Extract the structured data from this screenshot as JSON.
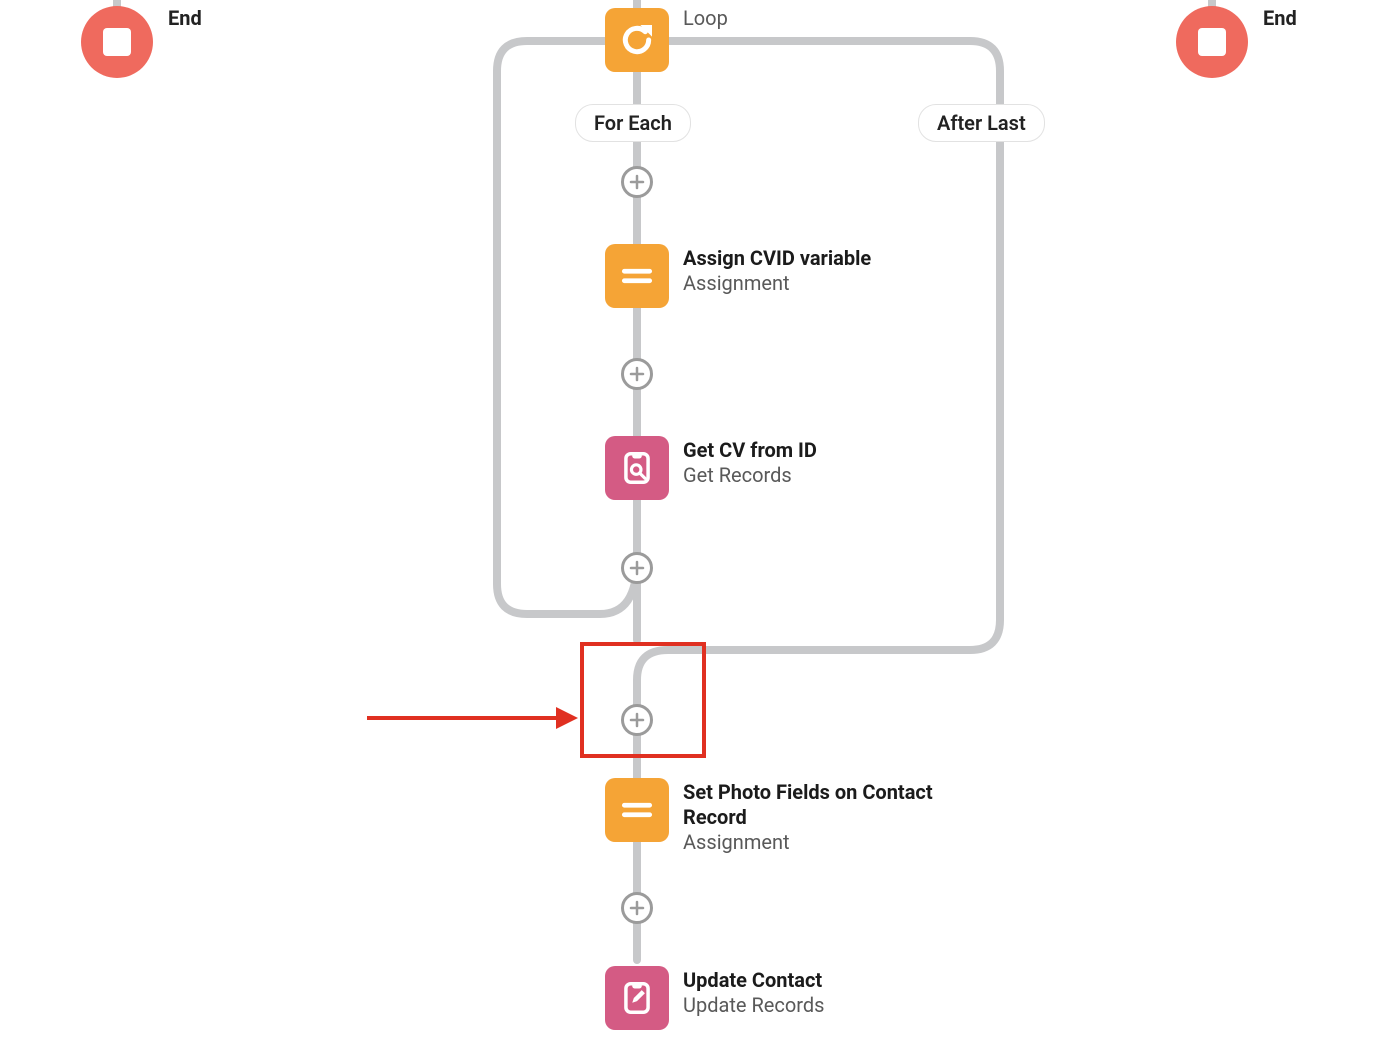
{
  "end_nodes": {
    "left": {
      "label": "End"
    },
    "right": {
      "label": "End"
    }
  },
  "loop": {
    "title": "",
    "subtitle": "Loop",
    "for_each_label": "For Each",
    "after_last_label": "After Last"
  },
  "elements": {
    "assign_cvid": {
      "title": "Assign CVID variable",
      "subtitle": "Assignment"
    },
    "get_cv": {
      "title": "Get CV from ID",
      "subtitle": "Get Records"
    },
    "set_photo": {
      "title": "Set Photo Fields on Contact Record",
      "subtitle": "Assignment"
    },
    "update_contact": {
      "title": "Update Contact",
      "subtitle": "Update Records"
    }
  }
}
